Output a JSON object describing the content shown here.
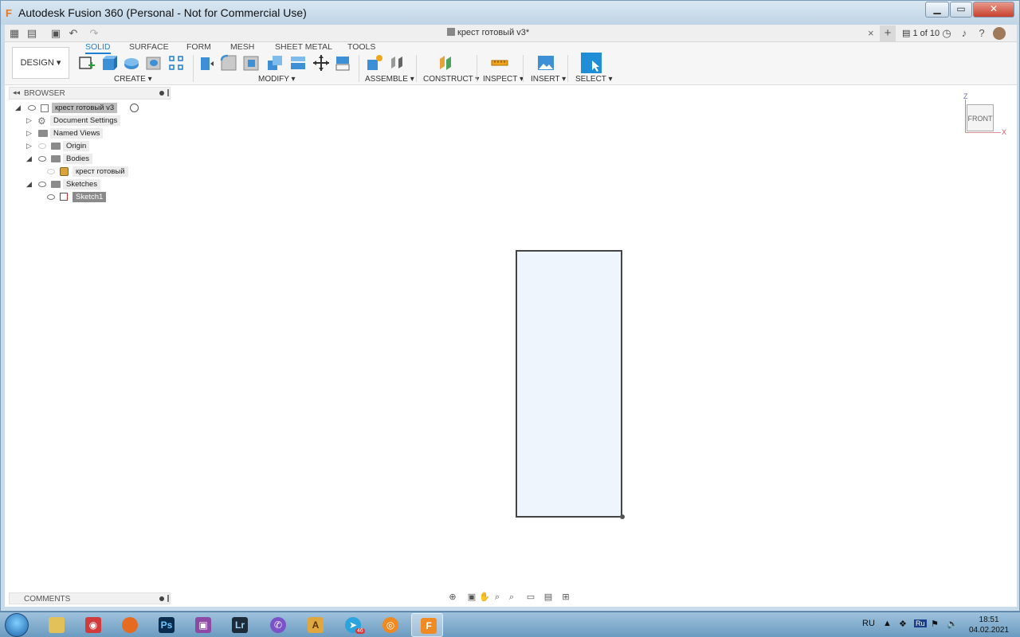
{
  "window": {
    "title": "Autodesk Fusion 360 (Personal - Not for Commercial Use)",
    "controls": {
      "minimize": "▁",
      "maximize": "▭",
      "close": "✕"
    }
  },
  "qat": {
    "doc_tab_title": "крест готовый v3*",
    "tab_close": "×",
    "tab_plus": "+",
    "pages": "1 of 10"
  },
  "ribbon": {
    "workspace": "DESIGN ▾",
    "tabs": [
      "SOLID",
      "SURFACE",
      "FORM",
      "MESH",
      "SHEET METAL",
      "TOOLS"
    ],
    "groups": {
      "create": "CREATE ▾",
      "modify": "MODIFY ▾",
      "assemble": "ASSEMBLE ▾",
      "construct": "CONSTRUCT ▾",
      "inspect": "INSPECT ▾",
      "insert": "INSERT ▾",
      "select": "SELECT ▾"
    }
  },
  "browser": {
    "header": "BROWSER",
    "root": "крест готовый v3",
    "items": {
      "doc_settings": "Document Settings",
      "named_views": "Named Views",
      "origin": "Origin",
      "bodies": "Bodies",
      "body1": "крест готовый",
      "sketches": "Sketches",
      "sketch1": "Sketch1"
    }
  },
  "viewcube": {
    "face": "FRONT",
    "z": "Z",
    "x": "X"
  },
  "comments": {
    "label": "COMMENTS"
  },
  "taskbar": {
    "lang": "RU",
    "lang2": "Ru",
    "time": "18:51",
    "date": "04.02.2021",
    "telegram_badge": "46"
  },
  "colors": {
    "accent": "#1f7fd1",
    "sketch_fill": "#eef5fc"
  }
}
